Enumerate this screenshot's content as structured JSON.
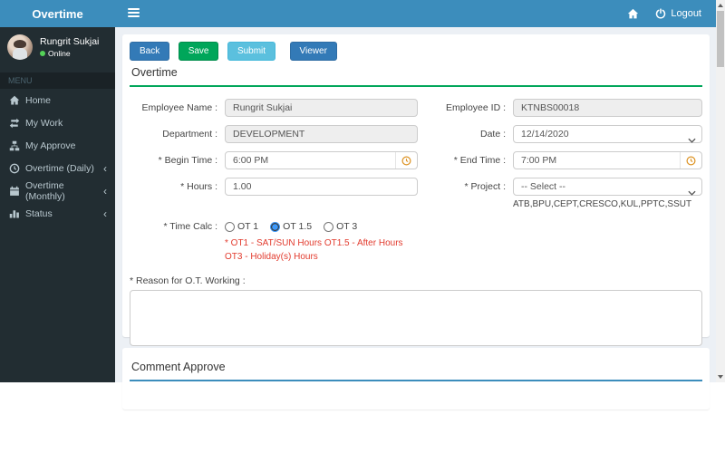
{
  "navbar": {
    "brand": "Overtime",
    "hamburger_icon": "bars-icon",
    "home_icon": "home-icon",
    "logout": {
      "icon": "power-icon",
      "label": "Logout"
    }
  },
  "sidebar": {
    "user": {
      "name": "Rungrit Sukjai",
      "status": "Online"
    },
    "menu_header": "MENU",
    "items": [
      {
        "label": "Home",
        "icon": "home-icon",
        "expandable": false
      },
      {
        "label": "My Work",
        "icon": "exchange-icon",
        "expandable": false
      },
      {
        "label": "My Approve",
        "icon": "sitemap-icon",
        "expandable": false
      },
      {
        "label": "Overtime (Daily)",
        "icon": "clock-icon",
        "expandable": true
      },
      {
        "label": "Overtime (Monthly)",
        "icon": "calendar-icon",
        "expandable": true
      },
      {
        "label": "Status",
        "icon": "chart-icon",
        "expandable": true
      }
    ],
    "chevron": "‹"
  },
  "toolbar": {
    "back": "Back",
    "save": "Save",
    "submit": "Submit",
    "viewer": "Viewer"
  },
  "form": {
    "section_title": "Overtime",
    "employee_name": {
      "label": "Employee Name :",
      "value": "Rungrit Sukjai"
    },
    "employee_id": {
      "label": "Employee ID :",
      "value": "KTNBS00018"
    },
    "department": {
      "label": "Department :",
      "value": "DEVELOPMENT"
    },
    "date": {
      "label": "Date :",
      "value": "12/14/2020"
    },
    "begin_time": {
      "label": "* Begin Time :",
      "value": "6:00 PM",
      "addon_icon": "clock-icon"
    },
    "end_time": {
      "label": "* End Time :",
      "value": "7:00 PM",
      "addon_icon": "clock-icon"
    },
    "hours": {
      "label": "* Hours :",
      "value": "1.00"
    },
    "project": {
      "label": "* Project :",
      "value": "-- Select --",
      "help": "ATB,BPU,CEPT,CRESCO,KUL,PPTC,SSUT"
    },
    "time_calc": {
      "label": "* Time Calc :",
      "options": [
        "OT 1",
        "OT 1.5",
        "OT 3"
      ],
      "selected": "OT 1.5",
      "note": "* OT1 - SAT/SUN Hours OT1.5 - After Hours OT3 - Holiday(s) Hours"
    },
    "reason": {
      "label": "* Reason for O.T. Working :",
      "value": ""
    }
  },
  "comment_section": {
    "title": "Comment Approve"
  },
  "colors": {
    "navbar_blue": "#3c8dbc",
    "sidebar_dark": "#222d32",
    "content_bg": "#ecf0f5",
    "primary_btn": "#337ab7",
    "success_green": "#00a65a",
    "info_blue": "#5bc0de",
    "note_red": "#e23b2e",
    "online_green": "#54d157",
    "comment_rule_blue": "#3c8dbc"
  }
}
